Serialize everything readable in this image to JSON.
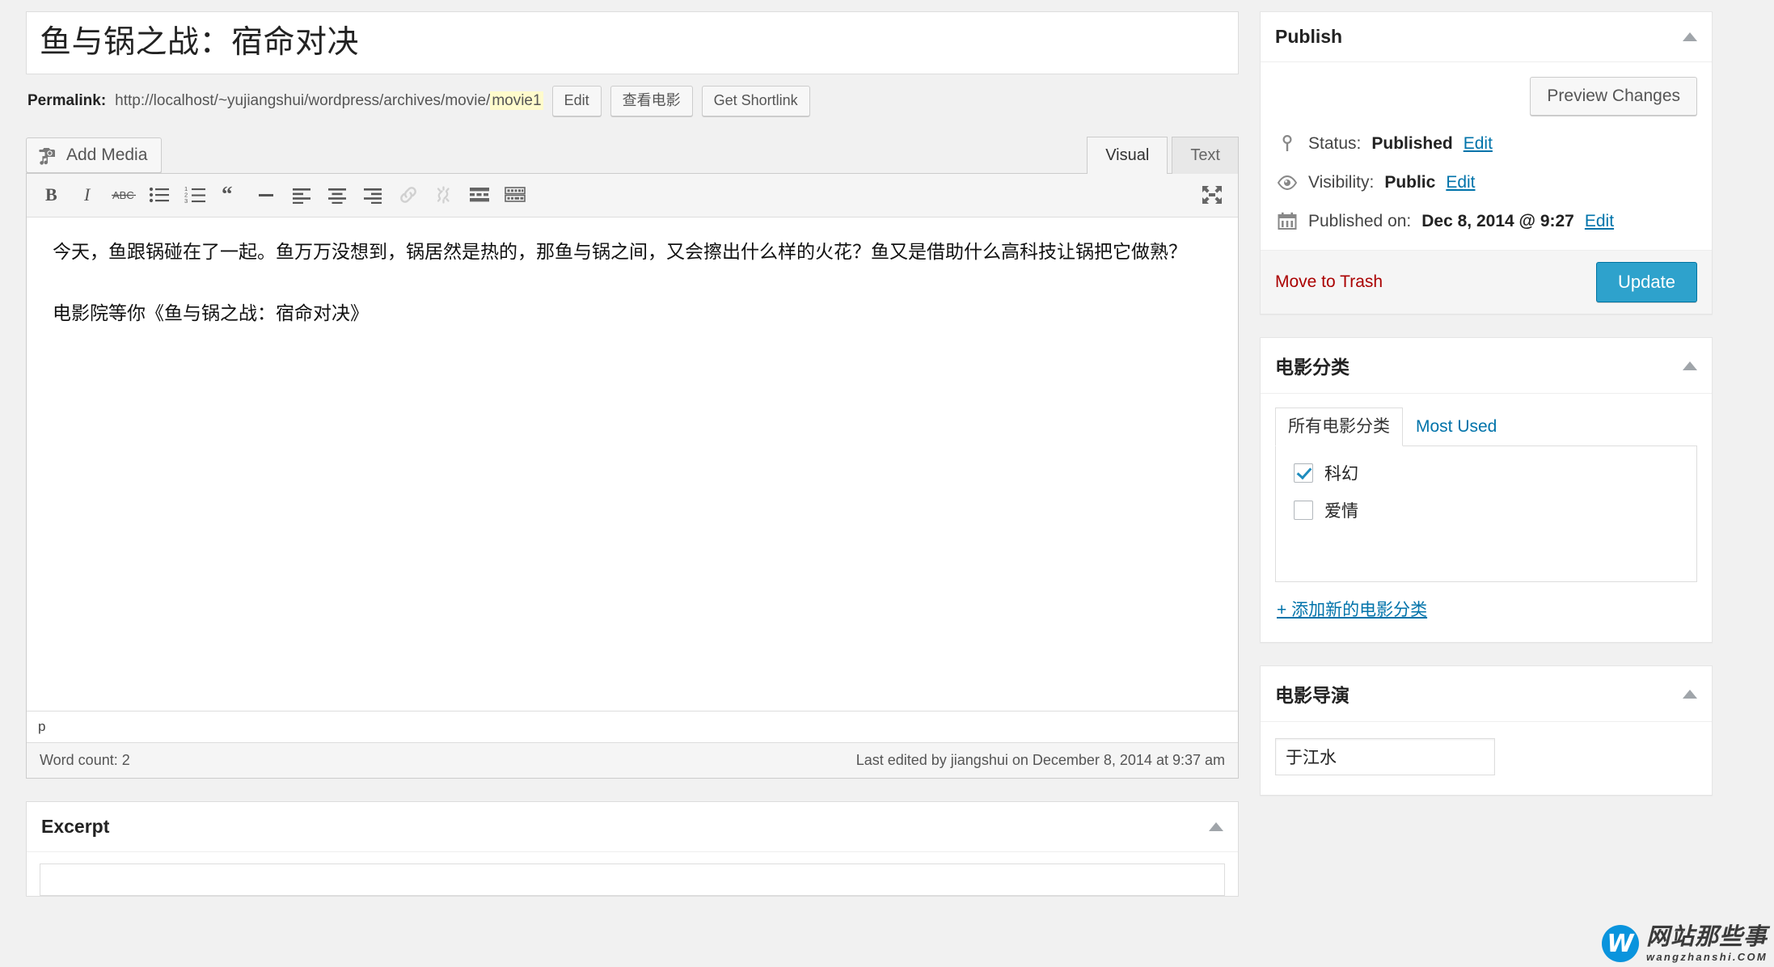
{
  "post": {
    "title": "鱼与锅之战：宿命对决",
    "permalink_label": "Permalink:",
    "permalink_base": "http://localhost/~yujiangshui/wordpress/archives/movie/",
    "permalink_slug": "movie1",
    "edit_slug_button": "Edit",
    "view_button": "查看电影",
    "shortlink_button": "Get Shortlink"
  },
  "editor": {
    "add_media_label": "Add Media",
    "tabs": [
      {
        "label": "Visual",
        "active": true
      },
      {
        "label": "Text",
        "active": false
      }
    ],
    "toolbar": [
      {
        "name": "bold",
        "title": "B"
      },
      {
        "name": "italic",
        "title": "I"
      },
      {
        "name": "strikethrough",
        "title": "ABC"
      },
      {
        "name": "bullet-list",
        "title": "Unordered list"
      },
      {
        "name": "numbered-list",
        "title": "Ordered list"
      },
      {
        "name": "blockquote",
        "title": "Blockquote"
      },
      {
        "name": "horizontal-rule",
        "title": "Horizontal line"
      },
      {
        "name": "align-left",
        "title": "Align left"
      },
      {
        "name": "align-center",
        "title": "Align center"
      },
      {
        "name": "align-right",
        "title": "Align right"
      },
      {
        "name": "insert-link",
        "title": "Insert link"
      },
      {
        "name": "unlink",
        "title": "Remove link"
      },
      {
        "name": "read-more",
        "title": "Insert Read More tag"
      },
      {
        "name": "kitchen-sink",
        "title": "Toolbar Toggle"
      },
      {
        "name": "fullscreen",
        "title": "Distraction-free writing mode"
      }
    ],
    "content": {
      "paragraph_1": "今天，鱼跟锅碰在了一起。鱼万万没想到，锅居然是热的，那鱼与锅之间，又会擦出什么样的火花？鱼又是借助什么高科技让锅把它做熟？",
      "paragraph_2": "电影院等你《鱼与锅之战：宿命对决》"
    },
    "path": "p",
    "word_count": "Word count: 2",
    "last_edited": "Last edited by jiangshui on December 8, 2014 at 9:37 am"
  },
  "excerpt": {
    "title": "Excerpt"
  },
  "publish": {
    "title": "Publish",
    "preview_button": "Preview Changes",
    "status_label": "Status:",
    "status_value": "Published",
    "status_edit": "Edit",
    "visibility_label": "Visibility:",
    "visibility_value": "Public",
    "visibility_edit": "Edit",
    "published_label": "Published on:",
    "published_value": "Dec 8, 2014 @ 9:27",
    "published_edit": "Edit",
    "trash_label": "Move to Trash",
    "update_button": "Update"
  },
  "category_panel": {
    "title": "电影分类",
    "tab_all": "所有电影分类",
    "tab_most_used": "Most Used",
    "items": [
      {
        "label": "科幻",
        "checked": true
      },
      {
        "label": "爱情",
        "checked": false
      }
    ],
    "add_new": "+ 添加新的电影分类"
  },
  "director_panel": {
    "title": "电影导演",
    "value": "于江水"
  },
  "watermark": {
    "mark": "W",
    "cn": "网站那些事",
    "en": "wangzhanshi.COM"
  },
  "colors": {
    "accent_blue": "#0073aa",
    "update_blue": "#2ea2cc",
    "trash_red": "#a00000",
    "slug_highlight": "#fffbcc"
  }
}
